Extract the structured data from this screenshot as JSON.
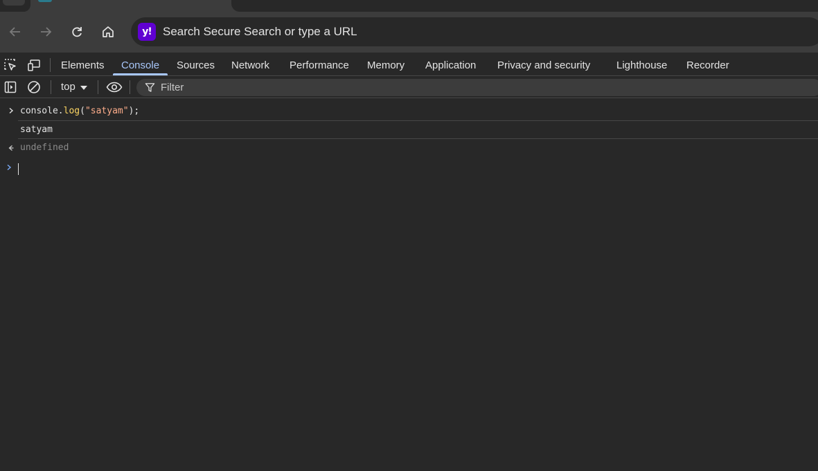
{
  "browser": {
    "omnibox": {
      "placeholder": "Search Secure Search or type a URL",
      "logo_text": "y!"
    },
    "colors": {
      "logo_bg": "#6001d2",
      "chrome_bg": "#3c3c3c",
      "page_bg": "#282828"
    }
  },
  "devtools": {
    "panel_tabs": [
      {
        "label": "Elements"
      },
      {
        "label": "Console",
        "active": true
      },
      {
        "label": "Sources"
      },
      {
        "label": "Network"
      },
      {
        "label": "Performance"
      },
      {
        "label": "Memory"
      },
      {
        "label": "Application"
      },
      {
        "label": "Privacy and security"
      },
      {
        "label": "Lighthouse"
      },
      {
        "label": "Recorder"
      }
    ],
    "console_toolbar": {
      "context": "top",
      "filter_placeholder": "Filter"
    },
    "messages": {
      "input": {
        "t1": "console",
        "t2": ".",
        "t3": "log",
        "t4": "(",
        "t5": "\"satyam\"",
        "t6": ");"
      },
      "log_output": "satyam",
      "return_value": "undefined"
    },
    "colors": {
      "accent": "#a8c7fa",
      "function_token": "#fdd663",
      "string_token": "#fcac8a",
      "muted": "#8a8a8a"
    }
  }
}
